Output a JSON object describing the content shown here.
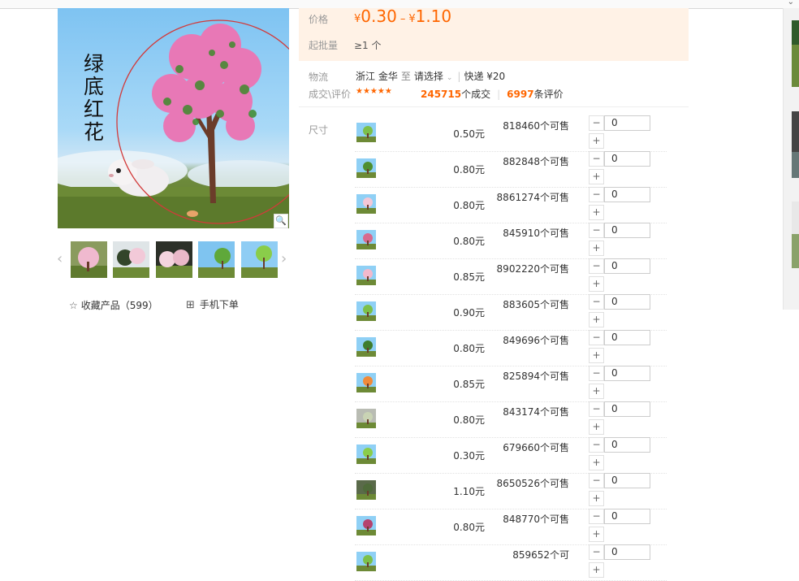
{
  "gallery": {
    "main_caption": [
      "绿",
      "底",
      "红",
      "花"
    ],
    "zoom_icon": "magnifier",
    "prev_icon": "chevron-left",
    "next_icon": "chevron-right",
    "favorite_label": "收藏产品（599）",
    "mobile_label": "手机下单"
  },
  "price_block": {
    "price_label": "价格",
    "currency": "¥",
    "price_min": "0.30",
    "price_sep": "–",
    "price_max": "1.10",
    "moq_label": "起批量",
    "moq_value": "≥1 个"
  },
  "logistics": {
    "label": "物流",
    "origin": "浙江 金华",
    "to": "至",
    "select": "请选择",
    "express": "快递 ¥20"
  },
  "reviews": {
    "label": "成交\\评价",
    "stars": "★★★★★",
    "deals_count": "245715",
    "deals_suffix": "个成交",
    "reviews_count": "6997",
    "reviews_suffix": "条评价"
  },
  "variants": {
    "label": "尺寸",
    "rows": [
      {
        "price": "0.50元",
        "stock": "818460个可售",
        "qty": "0"
      },
      {
        "price": "0.80元",
        "stock": "882848个可售",
        "qty": "0"
      },
      {
        "price": "0.80元",
        "stock": "8861274个可售",
        "qty": "0"
      },
      {
        "price": "0.80元",
        "stock": "845910个可售",
        "qty": "0"
      },
      {
        "price": "0.85元",
        "stock": "8902220个可售",
        "qty": "0"
      },
      {
        "price": "0.90元",
        "stock": "883605个可售",
        "qty": "0"
      },
      {
        "price": "0.80元",
        "stock": "849696个可售",
        "qty": "0"
      },
      {
        "price": "0.85元",
        "stock": "825894个可售",
        "qty": "0"
      },
      {
        "price": "0.80元",
        "stock": "843174个可售",
        "qty": "0"
      },
      {
        "price": "0.30元",
        "stock": "679660个可售",
        "qty": "0"
      },
      {
        "price": "1.10元",
        "stock": "8650526个可售",
        "qty": "0"
      },
      {
        "price": "0.80元",
        "stock": "848770个可售",
        "qty": "0"
      },
      {
        "price": "",
        "stock": "859652个可",
        "qty": "0"
      }
    ],
    "minus": "−",
    "plus": "+"
  },
  "colors": {
    "accent": "#ff6600",
    "price_bg": "#fff2e6"
  }
}
